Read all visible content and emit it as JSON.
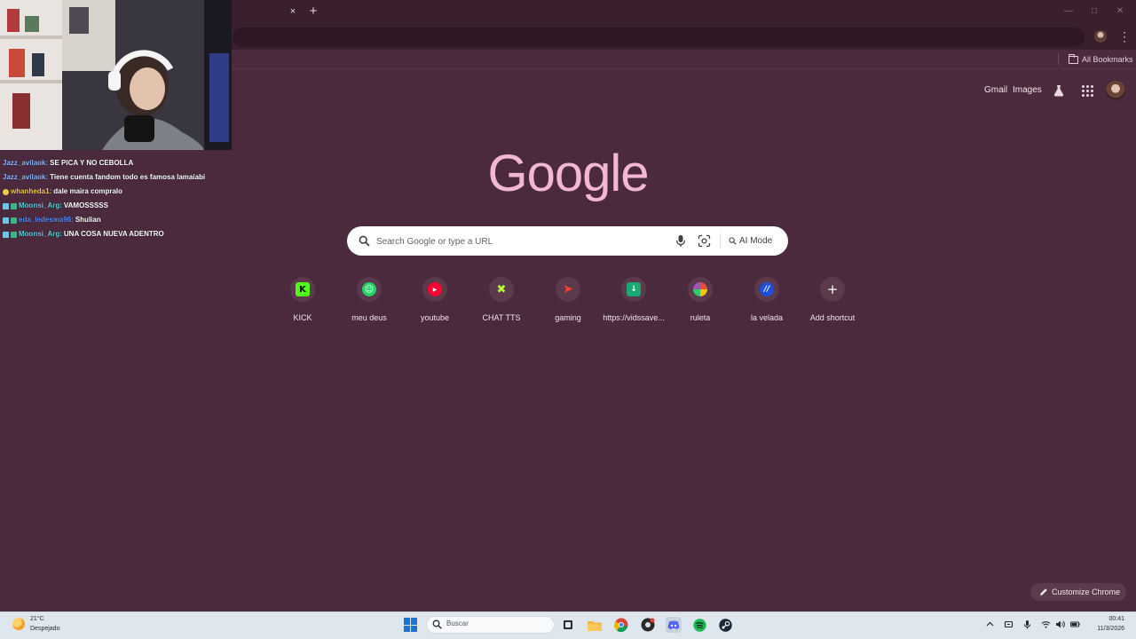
{
  "browser": {
    "tab_close_glyph": "×",
    "new_tab_glyph": "+",
    "bookmarks_label": "All Bookmarks"
  },
  "ntp": {
    "gmail_label": "Gmail",
    "images_label": "Images",
    "logo_text": "Google",
    "search": {
      "placeholder": "Search Google or type a URL",
      "ai_mode_label": "AI Mode"
    },
    "shortcuts": [
      {
        "label": "KICK",
        "icon": "kick-icon",
        "color": "#53fc18"
      },
      {
        "label": "meu deus",
        "icon": "smiley-icon",
        "color": "#25d366"
      },
      {
        "label": "youtube",
        "icon": "youtube-icon",
        "color": "#ff0033"
      },
      {
        "label": "CHAT TTS",
        "icon": "chat-tts-icon",
        "color": "#b8ff3d"
      },
      {
        "label": "gaming",
        "icon": "gaming-icon",
        "color": "#ff3b30"
      },
      {
        "label": "https://vidssave...",
        "icon": "download-icon",
        "color": "#19a974"
      },
      {
        "label": "ruleta",
        "icon": "wheel-icon",
        "color": "#9b59b6"
      },
      {
        "label": "la velada",
        "icon": "velada-icon",
        "color": "#1d4ed8"
      },
      {
        "label": "Add shortcut",
        "icon": "plus-icon",
        "color": "#ffffff"
      }
    ],
    "customize_label": "Customize Chrome"
  },
  "chat": [
    {
      "user": "Jazz_avilaok:",
      "message": "SE PICA Y NO CEBOLLA",
      "user_color": "#8fb5ff",
      "badges": []
    },
    {
      "user": "Jazz_avilaok:",
      "message": "Tiene cuenta fandom todo es famosa lamaiabi",
      "user_color": "#8fb5ff",
      "badges": []
    },
    {
      "user": "whanheda1:",
      "message": "dale maira compralo",
      "user_color": "#f2c94c",
      "badges": [
        "#f2c94c"
      ]
    },
    {
      "user": "Moonsi_Arg:",
      "message": "VAMOSSSSS",
      "user_color": "#5ad1e8",
      "badges": [
        "#5ad1e8",
        "#3fb48a"
      ]
    },
    {
      "user": "eda_ledesma96:",
      "message": "Shulian",
      "user_color": "#5a8cff",
      "badges": [
        "#5ad1e8",
        "#3fb48a"
      ]
    },
    {
      "user": "Moonsi_Arg:",
      "message": "UNA COSA NUEVA ADENTRO",
      "user_color": "#5ad1e8",
      "badges": [
        "#5ad1e8",
        "#3fb48a"
      ]
    }
  ],
  "taskbar": {
    "weather_temp": "21°C",
    "weather_desc": "Despejado",
    "search_label": "Buscar",
    "time": "00:41",
    "date": "11/3/2026"
  }
}
